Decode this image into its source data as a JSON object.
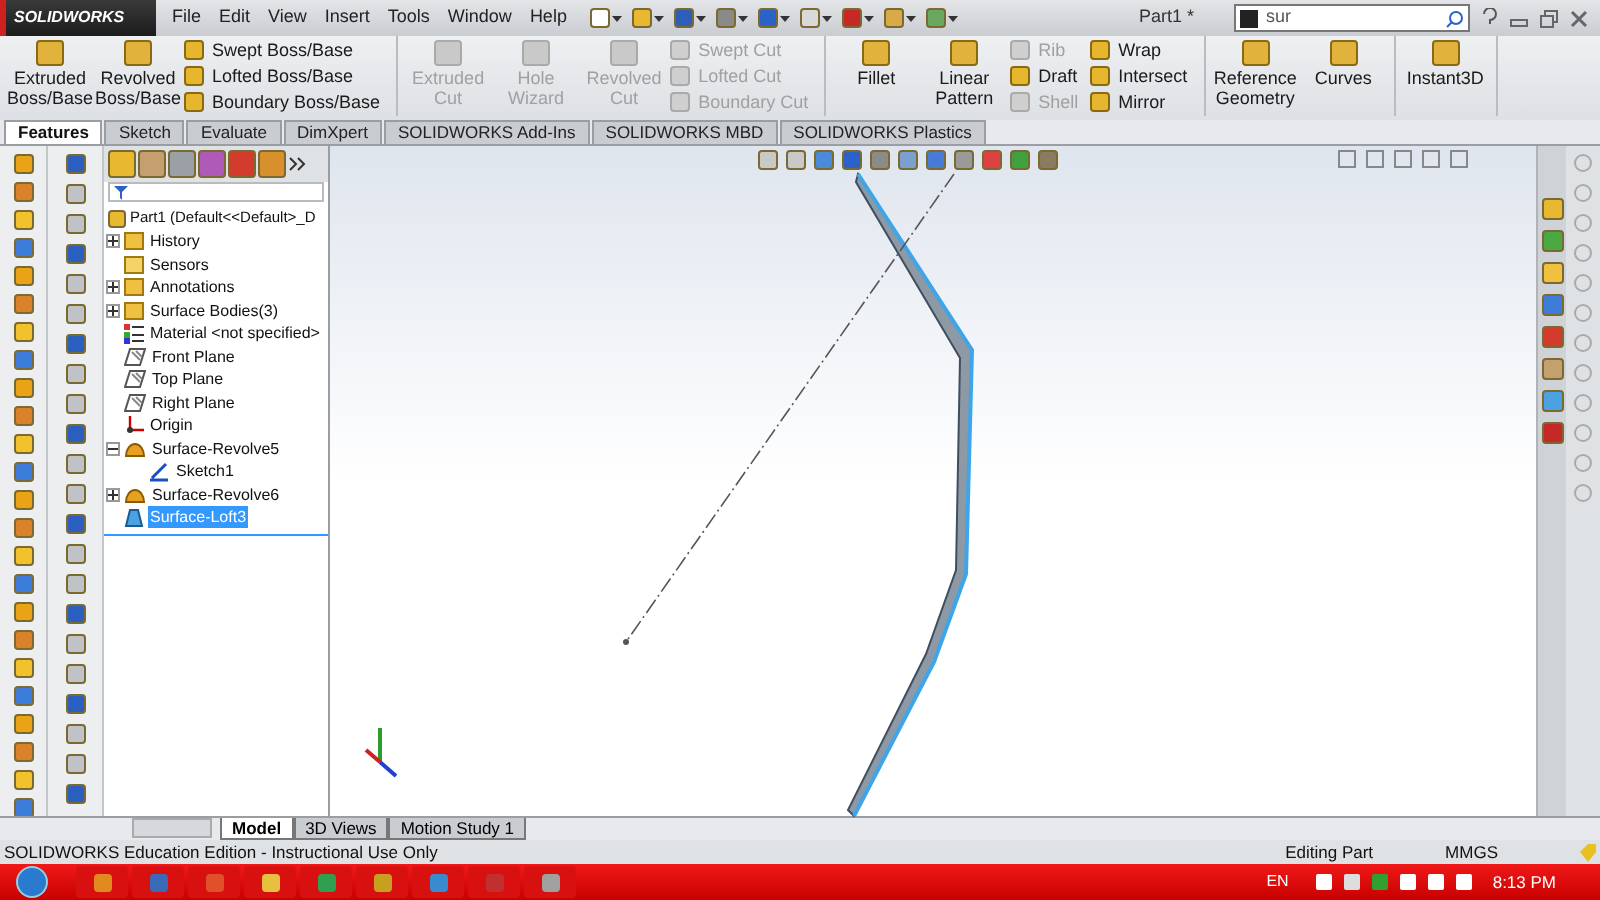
{
  "app": {
    "logo": "SOLIDWORKS",
    "title": "Part1 *"
  },
  "menu": [
    "File",
    "Edit",
    "View",
    "Insert",
    "Tools",
    "Window",
    "Help"
  ],
  "search": {
    "value": "sur"
  },
  "ribbon": [
    {
      "items": [
        {
          "kind": "large",
          "label": "Extruded Boss/Base",
          "disabled": false
        },
        {
          "kind": "large",
          "label": "Revolved Boss/Base",
          "disabled": false
        },
        {
          "kind": "stack",
          "items": [
            {
              "label": "Swept Boss/Base",
              "disabled": false
            },
            {
              "label": "Lofted Boss/Base",
              "disabled": false
            },
            {
              "label": "Boundary Boss/Base",
              "disabled": false
            }
          ]
        }
      ]
    },
    {
      "items": [
        {
          "kind": "large",
          "label": "Extruded Cut",
          "disabled": true
        },
        {
          "kind": "large",
          "label": "Hole Wizard",
          "disabled": true
        },
        {
          "kind": "large",
          "label": "Revolved Cut",
          "disabled": true
        },
        {
          "kind": "stack",
          "items": [
            {
              "label": "Swept Cut",
              "disabled": true
            },
            {
              "label": "Lofted Cut",
              "disabled": true
            },
            {
              "label": "Boundary Cut",
              "disabled": true
            }
          ]
        }
      ]
    },
    {
      "items": [
        {
          "kind": "large",
          "label": "Fillet",
          "disabled": false
        },
        {
          "kind": "large",
          "label": "Linear Pattern",
          "disabled": false
        },
        {
          "kind": "stack",
          "items": [
            {
              "label": "Rib",
              "disabled": true
            },
            {
              "label": "Draft",
              "disabled": false
            },
            {
              "label": "Shell",
              "disabled": true
            }
          ]
        },
        {
          "kind": "stack",
          "items": [
            {
              "label": "Wrap",
              "disabled": false
            },
            {
              "label": "Intersect",
              "disabled": false
            },
            {
              "label": "Mirror",
              "disabled": false
            }
          ]
        }
      ]
    },
    {
      "items": [
        {
          "kind": "large",
          "label": "Reference Geometry",
          "disabled": false
        },
        {
          "kind": "large",
          "label": "Curves",
          "disabled": false
        }
      ]
    },
    {
      "items": [
        {
          "kind": "large",
          "label": "Instant3D",
          "disabled": false
        }
      ]
    }
  ],
  "tabs": [
    {
      "label": "Features",
      "selected": true
    },
    {
      "label": "Sketch",
      "selected": false
    },
    {
      "label": "Evaluate",
      "selected": false
    },
    {
      "label": "DimXpert",
      "selected": false
    },
    {
      "label": "SOLIDWORKS Add-Ins",
      "selected": false
    },
    {
      "label": "SOLIDWORKS MBD",
      "selected": false
    },
    {
      "label": "SOLIDWORKS Plastics",
      "selected": false
    }
  ],
  "tree": {
    "root": "Part1  (Default<<Default>_D",
    "items": [
      {
        "label": "History",
        "kind": "folder",
        "expanded": false,
        "selected": false
      },
      {
        "label": "Sensors",
        "kind": "sensor",
        "selected": false
      },
      {
        "label": "Annotations",
        "kind": "folder",
        "expanded": false,
        "selected": false
      },
      {
        "label": "Surface Bodies(3)",
        "kind": "folder",
        "expanded": false,
        "selected": false
      },
      {
        "label": "Material <not specified>",
        "kind": "material",
        "selected": false
      },
      {
        "label": "Front Plane",
        "kind": "plane",
        "selected": false
      },
      {
        "label": "Top Plane",
        "kind": "plane",
        "selected": false
      },
      {
        "label": "Right Plane",
        "kind": "plane",
        "selected": false
      },
      {
        "label": "Origin",
        "kind": "origin",
        "selected": false
      },
      {
        "label": "Surface-Revolve5",
        "kind": "feature",
        "expanded": true,
        "selected": false,
        "children": [
          {
            "label": "Sketch1",
            "kind": "sketch",
            "selected": false
          }
        ]
      },
      {
        "label": "Surface-Revolve6",
        "kind": "feature",
        "expanded": false,
        "selected": false
      },
      {
        "label": "Surface-Loft3",
        "kind": "loft",
        "selected": true
      }
    ]
  },
  "bottom_tabs": [
    {
      "label": "Model",
      "selected": true
    },
    {
      "label": "3D Views",
      "selected": false
    },
    {
      "label": "Motion Study 1",
      "selected": false
    }
  ],
  "status": {
    "text": "SOLIDWORKS Education Edition - Instructional Use Only",
    "mode": "Editing Part",
    "units": "MMGS"
  },
  "taskbar": {
    "language": "EN",
    "time": "8:13 PM"
  }
}
